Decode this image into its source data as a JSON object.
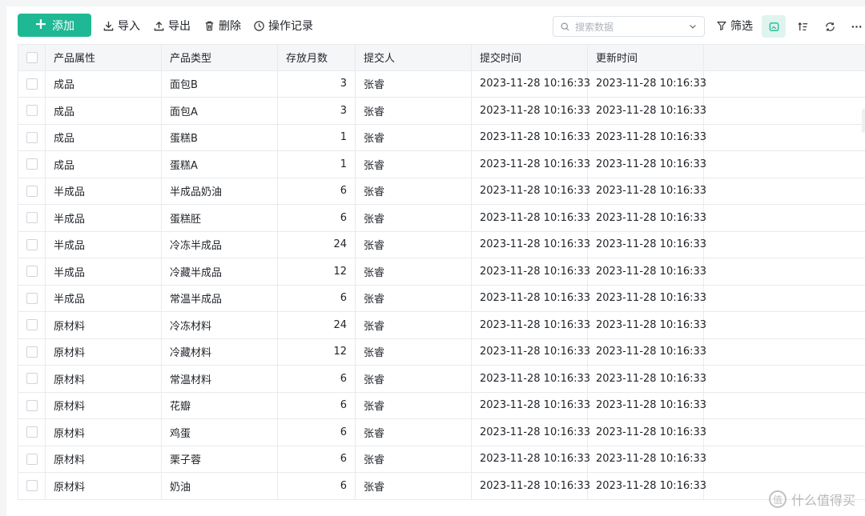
{
  "toolbar": {
    "add_label": "添加",
    "import_label": "导入",
    "export_label": "导出",
    "delete_label": "删除",
    "history_label": "操作记录",
    "search_placeholder": "搜索数据",
    "filter_label": "筛选",
    "accent_color": "#1fb894"
  },
  "table": {
    "headers": [
      "产品属性",
      "产品类型",
      "存放月数",
      "提交人",
      "提交时间",
      "更新时间"
    ],
    "rows": [
      [
        "成品",
        "面包B",
        "3",
        "张睿",
        "2023-11-28 10:16:33",
        "2023-11-28 10:16:33"
      ],
      [
        "成品",
        "面包A",
        "3",
        "张睿",
        "2023-11-28 10:16:33",
        "2023-11-28 10:16:33"
      ],
      [
        "成品",
        "蛋糕B",
        "1",
        "张睿",
        "2023-11-28 10:16:33",
        "2023-11-28 10:16:33"
      ],
      [
        "成品",
        "蛋糕A",
        "1",
        "张睿",
        "2023-11-28 10:16:33",
        "2023-11-28 10:16:33"
      ],
      [
        "半成品",
        "半成品奶油",
        "6",
        "张睿",
        "2023-11-28 10:16:33",
        "2023-11-28 10:16:33"
      ],
      [
        "半成品",
        "蛋糕胚",
        "6",
        "张睿",
        "2023-11-28 10:16:33",
        "2023-11-28 10:16:33"
      ],
      [
        "半成品",
        "冷冻半成品",
        "24",
        "张睿",
        "2023-11-28 10:16:33",
        "2023-11-28 10:16:33"
      ],
      [
        "半成品",
        "冷藏半成品",
        "12",
        "张睿",
        "2023-11-28 10:16:33",
        "2023-11-28 10:16:33"
      ],
      [
        "半成品",
        "常温半成品",
        "6",
        "张睿",
        "2023-11-28 10:16:33",
        "2023-11-28 10:16:33"
      ],
      [
        "原材料",
        "冷冻材料",
        "24",
        "张睿",
        "2023-11-28 10:16:33",
        "2023-11-28 10:16:33"
      ],
      [
        "原材料",
        "冷藏材料",
        "12",
        "张睿",
        "2023-11-28 10:16:33",
        "2023-11-28 10:16:33"
      ],
      [
        "原材料",
        "常温材料",
        "6",
        "张睿",
        "2023-11-28 10:16:33",
        "2023-11-28 10:16:33"
      ],
      [
        "原材料",
        "花瓣",
        "6",
        "张睿",
        "2023-11-28 10:16:33",
        "2023-11-28 10:16:33"
      ],
      [
        "原材料",
        "鸡蛋",
        "6",
        "张睿",
        "2023-11-28 10:16:33",
        "2023-11-28 10:16:33"
      ],
      [
        "原材料",
        "栗子蓉",
        "6",
        "张睿",
        "2023-11-28 10:16:33",
        "2023-11-28 10:16:33"
      ],
      [
        "原材料",
        "奶油",
        "6",
        "张睿",
        "2023-11-28 10:16:33",
        "2023-11-28 10:16:33"
      ]
    ]
  },
  "watermark": {
    "logo_char": "值",
    "text": "什么值得买"
  }
}
